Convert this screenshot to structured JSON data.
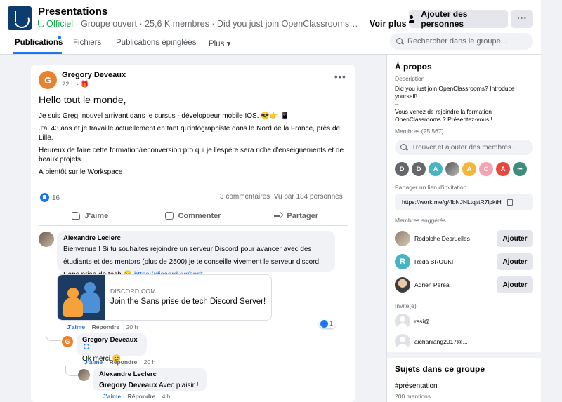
{
  "header": {
    "group_name": "Presentations",
    "official_label": "Officiel",
    "meta": " · Groupe ouvert · 25,6 K membres · Did you just join OpenClassrooms? Introdu...",
    "see_more": "Voir plus",
    "add_people": "Ajouter des personnes",
    "more": "···",
    "search_placeholder": "Rechercher dans le groupe..."
  },
  "tabs": [
    {
      "label": "Publications",
      "active": true
    },
    {
      "label": "Fichiers",
      "active": false
    },
    {
      "label": "Publications épinglées",
      "active": false
    },
    {
      "label": "Plus ▾",
      "active": false
    }
  ],
  "post": {
    "author": "Gregory Deveaux",
    "avatar_letter": "G",
    "time": "22 h · 🎁",
    "greeting": "Hello tout le monde,",
    "paragraphs": [
      "Je suis Greg, nouvel arrivant dans le cursus - développeur mobile IOS. 😎👉 📱",
      "J'ai 43 ans et je travaille actuellement en tant qu'infographiste dans le Nord de la France, près de Lille.",
      "Heureux de faire cette formation/reconversion pro qui je l'espère sera riche d'enseignements et de beaux projets.",
      "À bientôt sur le Workspace"
    ],
    "reaction_count": "16",
    "comments_count": "3 commentaires",
    "seen_by": "Vu par 184 personnes",
    "actions": {
      "like": "J'aime",
      "comment": "Commenter",
      "share": "Partager"
    }
  },
  "comments": [
    {
      "author": "Alexandre Leclerc",
      "text": "Bienvenue ! Si tu souhaites rejoindre un serveur Discord pour avancer avec des étudiants et des mentors (plus de 2500) je te conseille vivement le serveur discord Sans prise de tech 😉 ",
      "link": "https://discord.gg/spdt",
      "like": "J'aime",
      "reply": "Répondre",
      "time": "20 h",
      "reactions": "1"
    },
    {
      "author": "Gregory Deveaux",
      "text": "Ok merci 😊",
      "like": "J'aime",
      "reply": "Répondre",
      "time": "20 h"
    },
    {
      "author": "Alexandre Leclerc",
      "mention": "Gregory Deveaux",
      "text": " Avec plaisir !",
      "like": "J'aime",
      "reply": "Répondre",
      "time": "4 h"
    }
  ],
  "link_preview": {
    "domain": "DISCORD.COM",
    "title": "Join the Sans prise de tech Discord Server!"
  },
  "sidebar": {
    "about_title": "À propos",
    "description_label": "Description",
    "description": "Did you just join OpenClassrooms? Introduce yourself!\n--\nVous venez de rejoindre la formation OpenClassrooms ? Présentez-vous !",
    "members_label": "Membres (25 567)",
    "members_search": "Trouver et ajouter des membres...",
    "member_avatars": [
      {
        "letter": "D",
        "color": "#65676b"
      },
      {
        "letter": "D",
        "color": "#65676b"
      },
      {
        "letter": "A",
        "color": "#45b5c4"
      },
      {
        "letter": "",
        "color": "#8a8a8a"
      },
      {
        "letter": "A",
        "color": "#f2b63d"
      },
      {
        "letter": "C",
        "color": "#f5a3b4"
      },
      {
        "letter": "A",
        "color": "#e4483f"
      },
      {
        "letter": "•••",
        "color": "#3f8c7a"
      }
    ],
    "invite_label": "Partager un lien d'invitation",
    "invite_link": "https://work.me/g/4bNJNLtqj/tR7lpktH",
    "suggested_label": "Membres suggérés",
    "suggested": [
      {
        "name": "Rodolphe Desruelles",
        "button": "Ajouter"
      },
      {
        "name": "Reda BROUKI",
        "button": "Ajouter",
        "letter": "R"
      },
      {
        "name": "Adrien Perea",
        "button": "Ajouter"
      }
    ],
    "invited_label": "Invité(e)",
    "invited": [
      {
        "name": "rssi@..."
      },
      {
        "name": "aichaniang2017@..."
      }
    ],
    "topics_title": "Sujets dans ce groupe",
    "topic_tag": "#présentation",
    "topic_count": "200 mentions"
  }
}
